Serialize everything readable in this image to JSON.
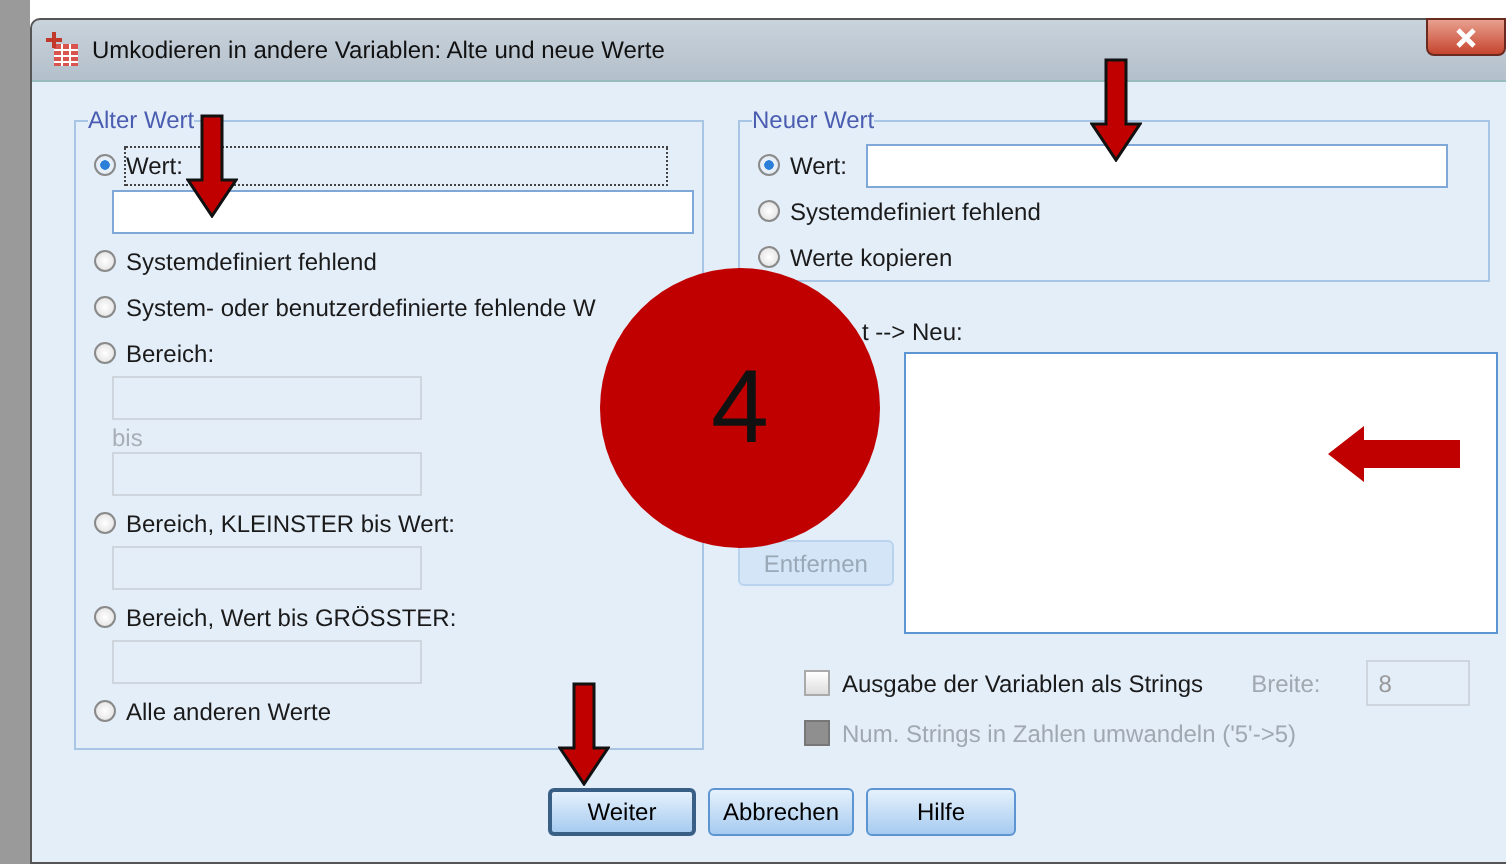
{
  "window": {
    "title": "Umkodieren in andere Variablen: Alte und neue Werte"
  },
  "old_value": {
    "legend": "Alter Wert",
    "items": [
      {
        "kind": "radio",
        "label": "Wert:",
        "selected": true,
        "focused": true
      },
      {
        "kind": "field",
        "disabled": false
      },
      {
        "kind": "radio",
        "label": "Systemdefiniert fehlend",
        "selected": false,
        "focused": false
      },
      {
        "kind": "radio",
        "label": "System- oder benutzerdefinierte fehlende W",
        "selected": false,
        "focused": false
      },
      {
        "kind": "radio",
        "label": "Bereich:",
        "selected": false,
        "focused": false
      },
      {
        "kind": "field",
        "disabled": true
      },
      {
        "kind": "caption",
        "label": "bis"
      },
      {
        "kind": "field",
        "disabled": true
      },
      {
        "kind": "radio",
        "label": "Bereich, KLEINSTER bis Wert:",
        "selected": false,
        "focused": false
      },
      {
        "kind": "field",
        "disabled": true
      },
      {
        "kind": "radio",
        "label": "Bereich, Wert bis GRÖSSTER:",
        "selected": false,
        "focused": false
      },
      {
        "kind": "field",
        "disabled": true
      },
      {
        "kind": "radio",
        "label": "Alle anderen Werte",
        "selected": false,
        "focused": false
      }
    ]
  },
  "new_value": {
    "legend": "Neuer Wert",
    "items": [
      {
        "kind": "radio_field",
        "label": "Wert:",
        "selected": true
      },
      {
        "kind": "radio",
        "label": "Systemdefiniert fehlend",
        "selected": false
      },
      {
        "kind": "radio",
        "label": "Werte kopieren",
        "selected": false
      }
    ]
  },
  "mapping": {
    "label": "t --> Neu:",
    "buttons": [
      {
        "label": "Entfernen",
        "disabled": true
      }
    ]
  },
  "checkboxes": [
    {
      "label": "Ausgabe der Variablen als Strings",
      "checked": false,
      "disabled": false
    },
    {
      "label": "Num. Strings in Zahlen umwandeln ('5'->5)",
      "checked": false,
      "disabled": true
    }
  ],
  "width_field": {
    "label": "Breite:",
    "value": "8",
    "disabled": true
  },
  "buttons": [
    {
      "label": "Weiter",
      "default": true
    },
    {
      "label": "Abbrechen",
      "default": false
    },
    {
      "label": "Hilfe",
      "default": false
    }
  ],
  "badge": "4"
}
